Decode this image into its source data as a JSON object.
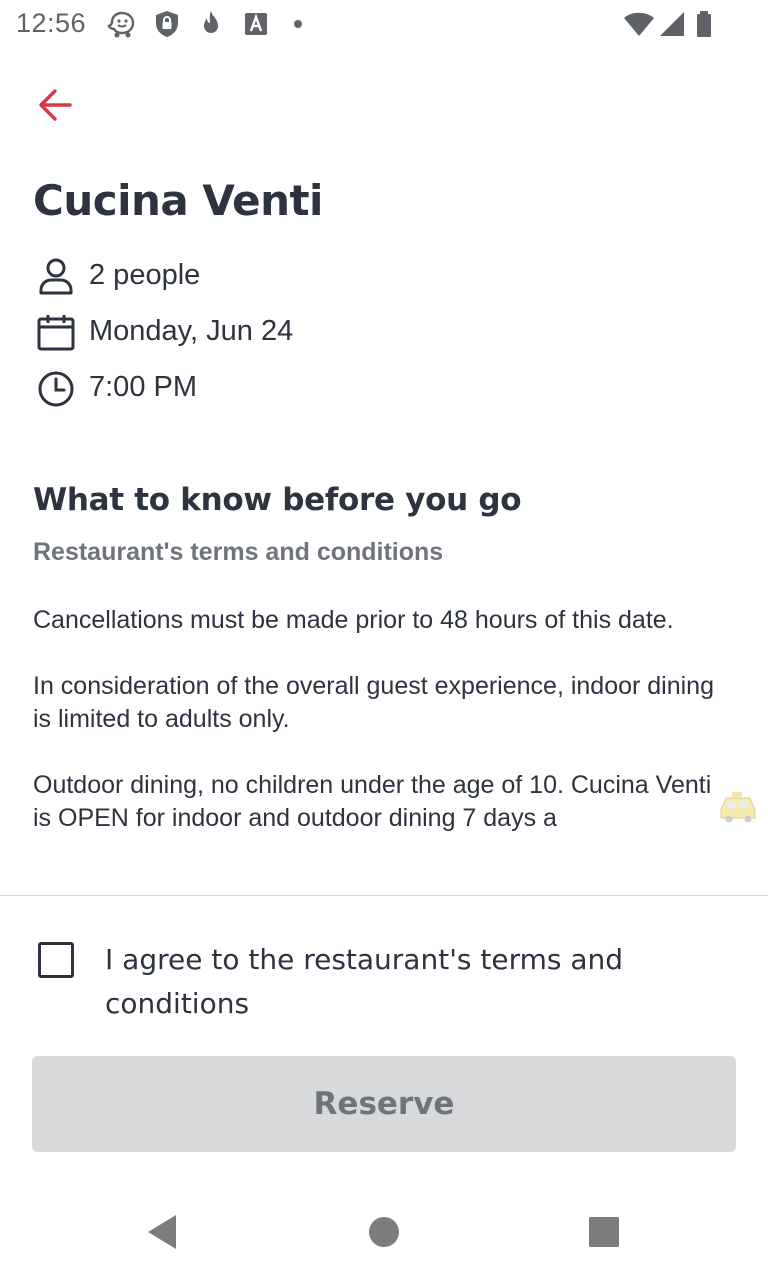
{
  "status_bar": {
    "time": "12:56",
    "icons": [
      "waze-icon",
      "shield-lock-icon",
      "flame-icon",
      "font-a-icon",
      "dot-icon",
      "wifi-icon",
      "signal-icon",
      "battery-icon"
    ]
  },
  "header": {
    "back_icon": "arrow-left-icon"
  },
  "restaurant": {
    "name": "Cucina Venti"
  },
  "details": {
    "party_size": "2 people",
    "date": "Monday, Jun 24",
    "time": "7:00 PM"
  },
  "info": {
    "heading": "What to know before you go",
    "subheading": "Restaurant's terms and conditions",
    "paragraphs": [
      "Cancellations must be made prior to 48 hours of this date.",
      "In consideration of the overall guest experience, indoor dining is limited to adults only.",
      "Outdoor dining, no children under the age of 10. Cucina Venti is OPEN for indoor and outdoor dining 7 days a"
    ]
  },
  "agreement": {
    "label": "I agree to the restaurant's terms and conditions",
    "checked": false
  },
  "actions": {
    "reserve_label": "Reserve"
  },
  "colors": {
    "accent": "#da3743",
    "text": "#2d333f",
    "muted": "#6f737b",
    "button_disabled_bg": "#d8d9db"
  }
}
